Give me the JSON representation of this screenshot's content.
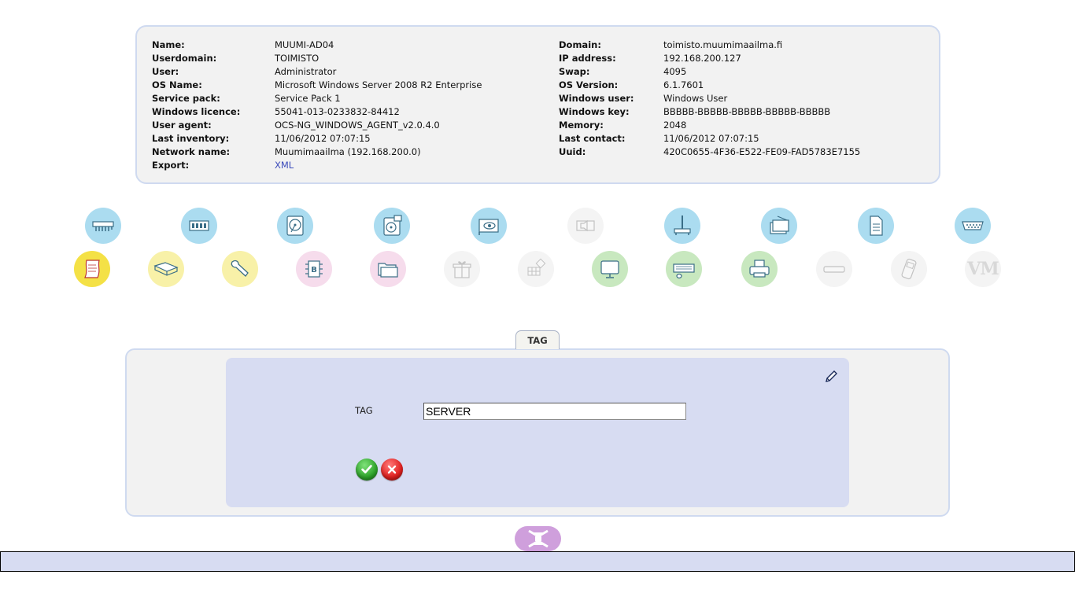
{
  "info": {
    "left": [
      {
        "label": "Name:",
        "value": "MUUMI-AD04"
      },
      {
        "label": "Userdomain:",
        "value": "TOIMISTO"
      },
      {
        "label": "User:",
        "value": "Administrator"
      },
      {
        "label": "OS Name:",
        "value": "Microsoft Windows Server 2008 R2 Enterprise"
      },
      {
        "label": "Service pack:",
        "value": "Service Pack 1"
      },
      {
        "label": "Windows licence:",
        "value": "55041-013-0233832-84412"
      },
      {
        "label": "User agent:",
        "value": "OCS-NG_WINDOWS_AGENT_v2.0.4.0"
      },
      {
        "label": "Last inventory:",
        "value": "11/06/2012 07:07:15"
      },
      {
        "label": "Network name:",
        "value": "Muumimaailma (192.168.200.0)"
      },
      {
        "label": "Export:",
        "value": "XML"
      }
    ],
    "right": [
      {
        "label": "Domain:",
        "value": "toimisto.muumimaailma.fi"
      },
      {
        "label": "IP address:",
        "value": "192.168.200.127"
      },
      {
        "label": "Swap:",
        "value": "4095"
      },
      {
        "label": "OS Version:",
        "value": "6.1.7601"
      },
      {
        "label": "Windows user:",
        "value": "Windows User"
      },
      {
        "label": "Windows key:",
        "value": "BBBBB-BBBBB-BBBBB-BBBBB-BBBBB"
      },
      {
        "label": "Memory:",
        "value": "2048"
      },
      {
        "label": "Last contact:",
        "value": "11/06/2012 07:07:15"
      },
      {
        "label": "Uuid:",
        "value": "420C0655-4F36-E522-FE09-FAD5783E7155"
      }
    ]
  },
  "icons": {
    "row1": [
      "ram-slots-icon",
      "memory-icon",
      "hard-disk-icon",
      "drive-icon",
      "video-card-icon",
      "sound-icon",
      "network-icon",
      "controllers-icon",
      "registry-icon",
      "ports-icon"
    ],
    "row2": [
      "software-icon",
      "documentation-icon",
      "tools-icon",
      "bios-icon",
      "folders-icon",
      "packages-icon",
      "groups-icon",
      "monitor-icon",
      "input-devices-icon",
      "printer-icon",
      "modems-icon",
      "mobile-icon"
    ],
    "vm_text": "VM"
  },
  "tag_section": {
    "tab_label": "TAG",
    "field_label": "TAG",
    "field_value": "SERVER"
  },
  "colors": {
    "panel_bg": "#f2f2f2",
    "panel_border": "#cfdaf0",
    "inner_bg": "#d7dcf2",
    "link": "#3d4dbb",
    "toggle": "#cf9fdc"
  }
}
